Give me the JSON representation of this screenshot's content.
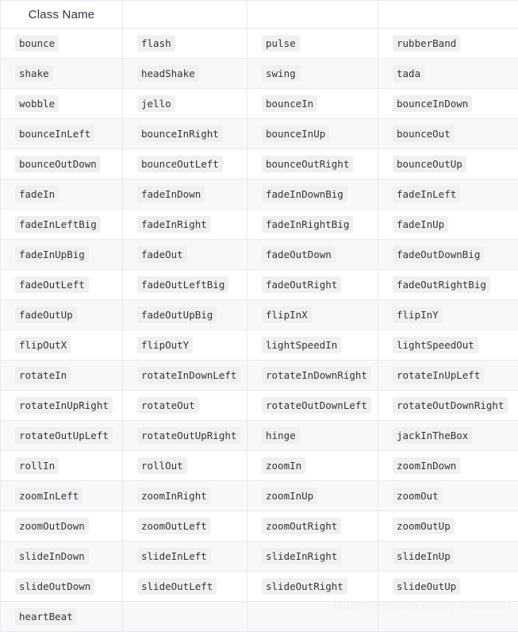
{
  "table": {
    "headers": [
      "Class Name",
      "",
      "",
      ""
    ],
    "rows": [
      [
        "bounce",
        "flash",
        "pulse",
        "rubberBand"
      ],
      [
        "shake",
        "headShake",
        "swing",
        "tada"
      ],
      [
        "wobble",
        "jello",
        "bounceIn",
        "bounceInDown"
      ],
      [
        "bounceInLeft",
        "bounceInRight",
        "bounceInUp",
        "bounceOut"
      ],
      [
        "bounceOutDown",
        "bounceOutLeft",
        "bounceOutRight",
        "bounceOutUp"
      ],
      [
        "fadeIn",
        "fadeInDown",
        "fadeInDownBig",
        "fadeInLeft"
      ],
      [
        "fadeInLeftBig",
        "fadeInRight",
        "fadeInRightBig",
        "fadeInUp"
      ],
      [
        "fadeInUpBig",
        "fadeOut",
        "fadeOutDown",
        "fadeOutDownBig"
      ],
      [
        "fadeOutLeft",
        "fadeOutLeftBig",
        "fadeOutRight",
        "fadeOutRightBig"
      ],
      [
        "fadeOutUp",
        "fadeOutUpBig",
        "flipInX",
        "flipInY"
      ],
      [
        "flipOutX",
        "flipOutY",
        "lightSpeedIn",
        "lightSpeedOut"
      ],
      [
        "rotateIn",
        "rotateInDownLeft",
        "rotateInDownRight",
        "rotateInUpLeft"
      ],
      [
        "rotateInUpRight",
        "rotateOut",
        "rotateOutDownLeft",
        "rotateOutDownRight"
      ],
      [
        "rotateOutUpLeft",
        "rotateOutUpRight",
        "hinge",
        "jackInTheBox"
      ],
      [
        "rollIn",
        "rollOut",
        "zoomIn",
        "zoomInDown"
      ],
      [
        "zoomInLeft",
        "zoomInRight",
        "zoomInUp",
        "zoomOut"
      ],
      [
        "zoomOutDown",
        "zoomOutLeft",
        "zoomOutRight",
        "zoomOutUp"
      ],
      [
        "slideInDown",
        "slideInLeft",
        "slideInRight",
        "slideInUp"
      ],
      [
        "slideOutDown",
        "slideOutLeft",
        "slideOutRight",
        "slideOutUp"
      ],
      [
        "heartBeat",
        "",
        "",
        ""
      ]
    ]
  },
  "watermark": {
    "text": "https://blog.csdn.net/qq_44182284"
  },
  "colors": {
    "row_alt_background": "#f6f8fa",
    "row_background": "#ffffff",
    "border": "#e8eaed",
    "code_background": "#f0f0f0",
    "code_text": "#33353a",
    "header_text": "#2f3640",
    "watermark_text": "#f1f2f4"
  }
}
